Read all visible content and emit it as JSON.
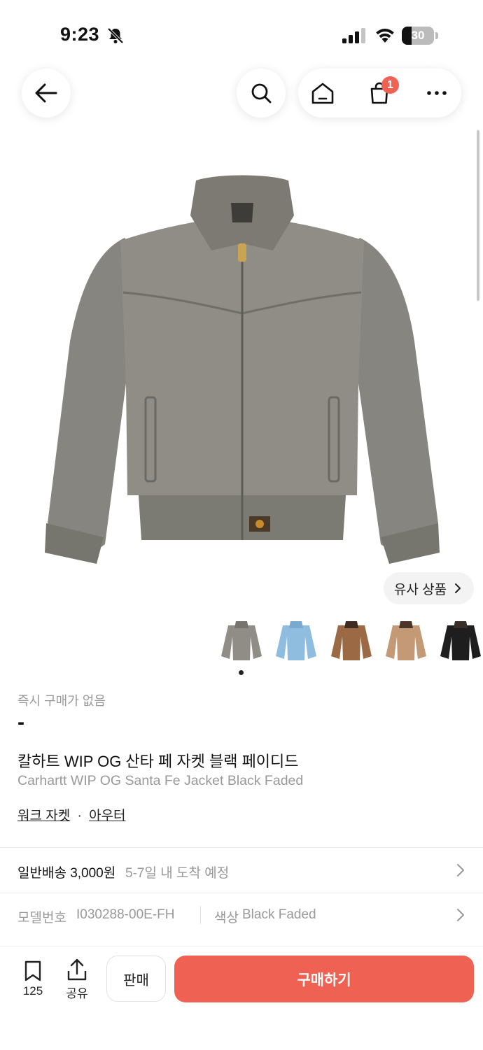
{
  "status_bar": {
    "time": "9:23",
    "battery": "30",
    "battery_level": 0.3
  },
  "nav": {
    "cart_badge": "1"
  },
  "gallery": {
    "similar_label": "유사 상품",
    "thumbnails": [
      "gray",
      "light-blue",
      "brown",
      "tan",
      "black"
    ],
    "selected_index": 0
  },
  "product": {
    "price_label": "즉시 구매가 없음",
    "price_value": "-",
    "title_ko": "칼하트 WIP OG 산타 페 자켓 블랙 페이디드",
    "title_en": "Carhartt WIP OG Santa Fe Jacket Black Faded",
    "category_1": "워크 자켓",
    "category_sep": "·",
    "category_2": "아우터"
  },
  "delivery": {
    "label": "일반배송 3,000원",
    "eta": "5-7일 내 도착 예정"
  },
  "info": {
    "model_label": "모델번호",
    "model_value": "I030288-00E-FH",
    "color_label": "색상",
    "color_value": "Black Faded"
  },
  "bottom_bar": {
    "bookmark_count": "125",
    "share_label": "공유",
    "sell_label": "판매",
    "buy_label": "구매하기"
  },
  "colors": {
    "accent": "#ef6253",
    "jacket_gray": "#8f8d86"
  }
}
